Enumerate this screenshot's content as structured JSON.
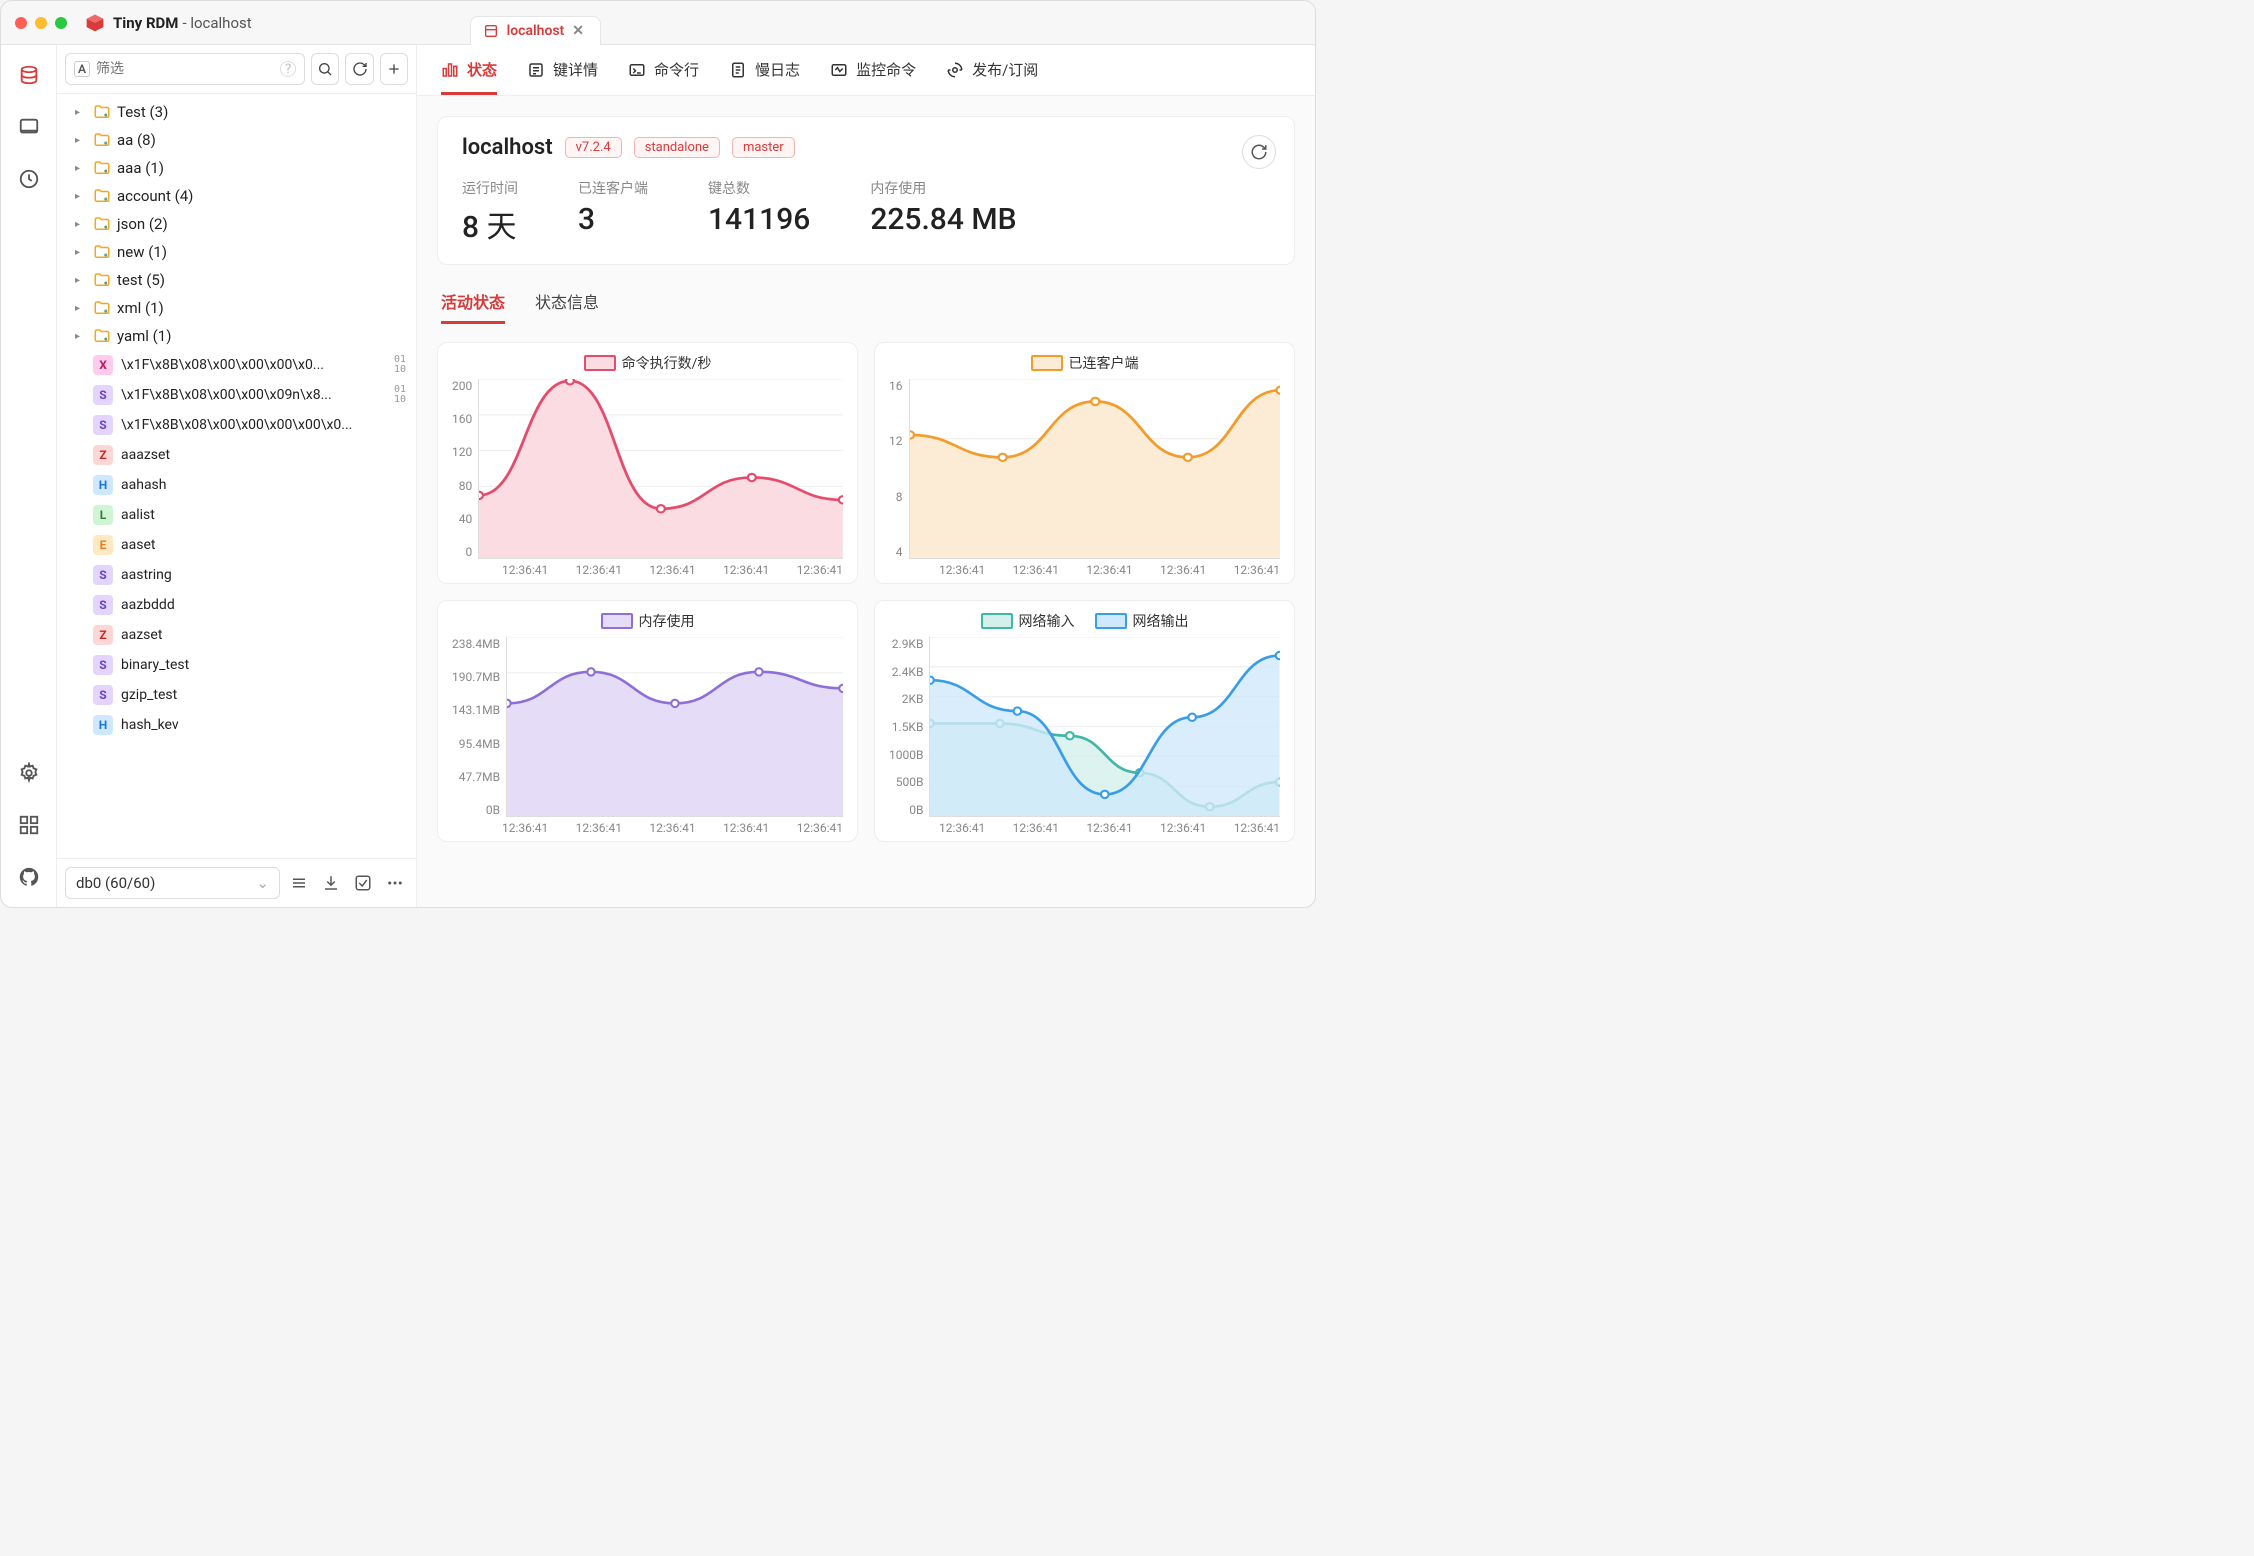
{
  "window": {
    "app_name": "Tiny RDM",
    "subtitle": "- localhost"
  },
  "tab": {
    "label": "localhost"
  },
  "sidebar": {
    "filter_placeholder": "筛选",
    "folders": [
      {
        "label": "Test (3)"
      },
      {
        "label": "aa (8)"
      },
      {
        "label": "aaa (1)"
      },
      {
        "label": "account (4)"
      },
      {
        "label": "json (2)"
      },
      {
        "label": "new (1)"
      },
      {
        "label": "test (5)"
      },
      {
        "label": "xml (1)"
      },
      {
        "label": "yaml (1)"
      }
    ],
    "keys": [
      {
        "type": "X",
        "label": "\\x1F\\x8B\\x08\\x00\\x00\\x00\\x0...",
        "binary": true
      },
      {
        "type": "S",
        "label": "\\x1F\\x8B\\x08\\x00\\x00\\x09n\\x8...",
        "binary": true
      },
      {
        "type": "S",
        "label": "\\x1F\\x8B\\x08\\x00\\x00\\x00\\x00\\x0...",
        "binary": false
      },
      {
        "type": "Z",
        "label": "aaazset"
      },
      {
        "type": "H",
        "label": "aahash"
      },
      {
        "type": "L",
        "label": "aalist"
      },
      {
        "type": "E",
        "label": "aaset"
      },
      {
        "type": "S",
        "label": "aastring"
      },
      {
        "type": "S",
        "label": "aazbddd"
      },
      {
        "type": "Z",
        "label": "aazset"
      },
      {
        "type": "S",
        "label": "binary_test"
      },
      {
        "type": "S",
        "label": "gzip_test"
      },
      {
        "type": "H",
        "label": "hash_kev"
      }
    ],
    "db_select": "db0 (60/60)"
  },
  "mainTabs": [
    {
      "label": "状态",
      "active": true
    },
    {
      "label": "键详情"
    },
    {
      "label": "命令行"
    },
    {
      "label": "慢日志"
    },
    {
      "label": "监控命令"
    },
    {
      "label": "发布/订阅"
    }
  ],
  "info": {
    "name": "localhost",
    "tags": [
      "v7.2.4",
      "standalone",
      "master"
    ],
    "stats": [
      {
        "label": "运行时间",
        "value": "8 天"
      },
      {
        "label": "已连客户端",
        "value": "3"
      },
      {
        "label": "键总数",
        "value": "141196"
      },
      {
        "label": "内存使用",
        "value": "225.84 MB"
      }
    ]
  },
  "subTabs": [
    {
      "label": "活动状态",
      "active": true
    },
    {
      "label": "状态信息"
    }
  ],
  "chart_data": [
    {
      "type": "area",
      "title": "命令执行数/秒",
      "color": "#e54b6b",
      "fill": "#fadce2",
      "ylabels": [
        "200",
        "160",
        "120",
        "80",
        "40",
        "0"
      ],
      "xlabels": [
        "12:36:41",
        "12:36:41",
        "12:36:41",
        "12:36:41",
        "12:36:41"
      ],
      "x": [
        0,
        1,
        2,
        3,
        4
      ],
      "values": [
        70,
        198,
        55,
        90,
        65
      ],
      "ylim": [
        0,
        200
      ]
    },
    {
      "type": "area",
      "title": "已连客户端",
      "color": "#f39c2c",
      "fill": "#fcecd5",
      "ylabels": [
        "16",
        "12",
        "8",
        "4"
      ],
      "xlabels": [
        "12:36:41",
        "12:36:41",
        "12:36:41",
        "12:36:41",
        "12:36:41"
      ],
      "x": [
        0,
        1,
        2,
        3,
        4
      ],
      "values": [
        13,
        11,
        16,
        11,
        17
      ],
      "ylim": [
        2,
        18
      ]
    },
    {
      "type": "area",
      "title": "内存使用",
      "color": "#8e6fd9",
      "fill": "#e5ddf7",
      "ylabels": [
        "238.4MB",
        "190.7MB",
        "143.1MB",
        "95.4MB",
        "47.7MB",
        "0B"
      ],
      "xlabels": [
        "12:36:41",
        "12:36:41",
        "12:36:41",
        "12:36:41",
        "12:36:41"
      ],
      "x": [
        0,
        1,
        2,
        3,
        4
      ],
      "values": [
        150,
        192,
        150,
        192,
        170
      ],
      "ylim": [
        0,
        238.4
      ]
    },
    {
      "type": "area-multi",
      "series": [
        {
          "name": "网络输入",
          "color": "#3fb8a6",
          "fill": "#d3f0eb",
          "values": [
            1500,
            1500,
            1300,
            700,
            150,
            550
          ]
        },
        {
          "name": "网络输出",
          "color": "#3a9de8",
          "fill": "#d0e8fb",
          "values": [
            2200,
            1700,
            350,
            1600,
            2600
          ]
        }
      ],
      "ylabels": [
        "2.9KB",
        "2.4KB",
        "2KB",
        "1.5KB",
        "1000B",
        "500B",
        "0B"
      ],
      "xlabels": [
        "12:36:41",
        "12:36:41",
        "12:36:41",
        "12:36:41",
        "12:36:41"
      ],
      "ylim": [
        0,
        2900
      ]
    }
  ],
  "colors": {
    "accent": "#d93b3b"
  }
}
